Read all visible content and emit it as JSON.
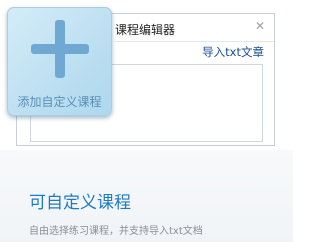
{
  "editor": {
    "title": "课程编辑器",
    "close_icon": "close-icon",
    "close_glyph": "✕",
    "import_link": "导入txt文章"
  },
  "add_tile": {
    "icon": "plus-icon",
    "label": "添加自定义课程"
  },
  "feature": {
    "title": "可自定义课程",
    "description": "自由选择练习课程，并支持导入txt文档"
  },
  "colors": {
    "accent_blue": "#1f7bc1",
    "tile_bg": "#bcdff1",
    "plus": "#6fa8d2",
    "link": "#1a4d94"
  }
}
